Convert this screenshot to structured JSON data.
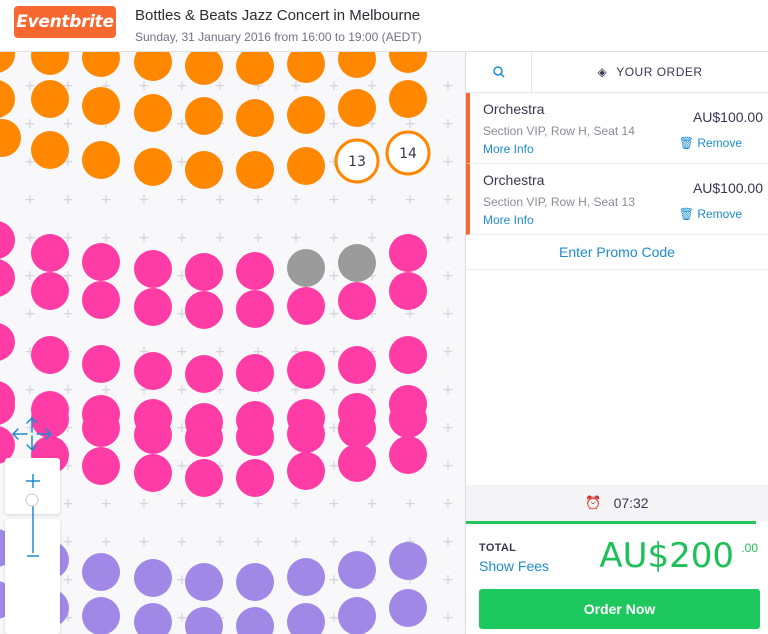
{
  "header": {
    "logo_text": "Eventbrite",
    "event_title": "Bottles & Beats Jazz Concert in Melbourne",
    "event_date": "Sunday, 31 January 2016 from 16:00 to 19:00 (AEDT)"
  },
  "seat_map": {
    "colors": {
      "vip": "#ff8800",
      "pink": "#ff3ba6",
      "purple": "#a089e6",
      "unavailable": "#9b9b9b"
    },
    "selected_seats": [
      "13",
      "14"
    ],
    "controls": {
      "pan_icon": "move-arrows-icon",
      "zoom_in": "+",
      "zoom_out": "–"
    }
  },
  "sidebar": {
    "tabs": {
      "search_icon": "search-icon",
      "order_label": "YOUR ORDER",
      "order_icon": "ticket-icon"
    },
    "order_items": [
      {
        "name": "Orchestra",
        "detail": "Section VIP, Row H, Seat 14",
        "more_info": "More Info",
        "price": "AU$100.00",
        "remove": "Remove"
      },
      {
        "name": "Orchestra",
        "detail": "Section VIP, Row H, Seat 13",
        "more_info": "More Info",
        "price": "AU$100.00",
        "remove": "Remove"
      }
    ],
    "promo_label": "Enter Promo Code",
    "timer": "07:32",
    "total_label": "TOTAL",
    "show_fees": "Show Fees",
    "total_amount": "AU$200",
    "total_cents": ".00",
    "order_button": "Order Now"
  }
}
